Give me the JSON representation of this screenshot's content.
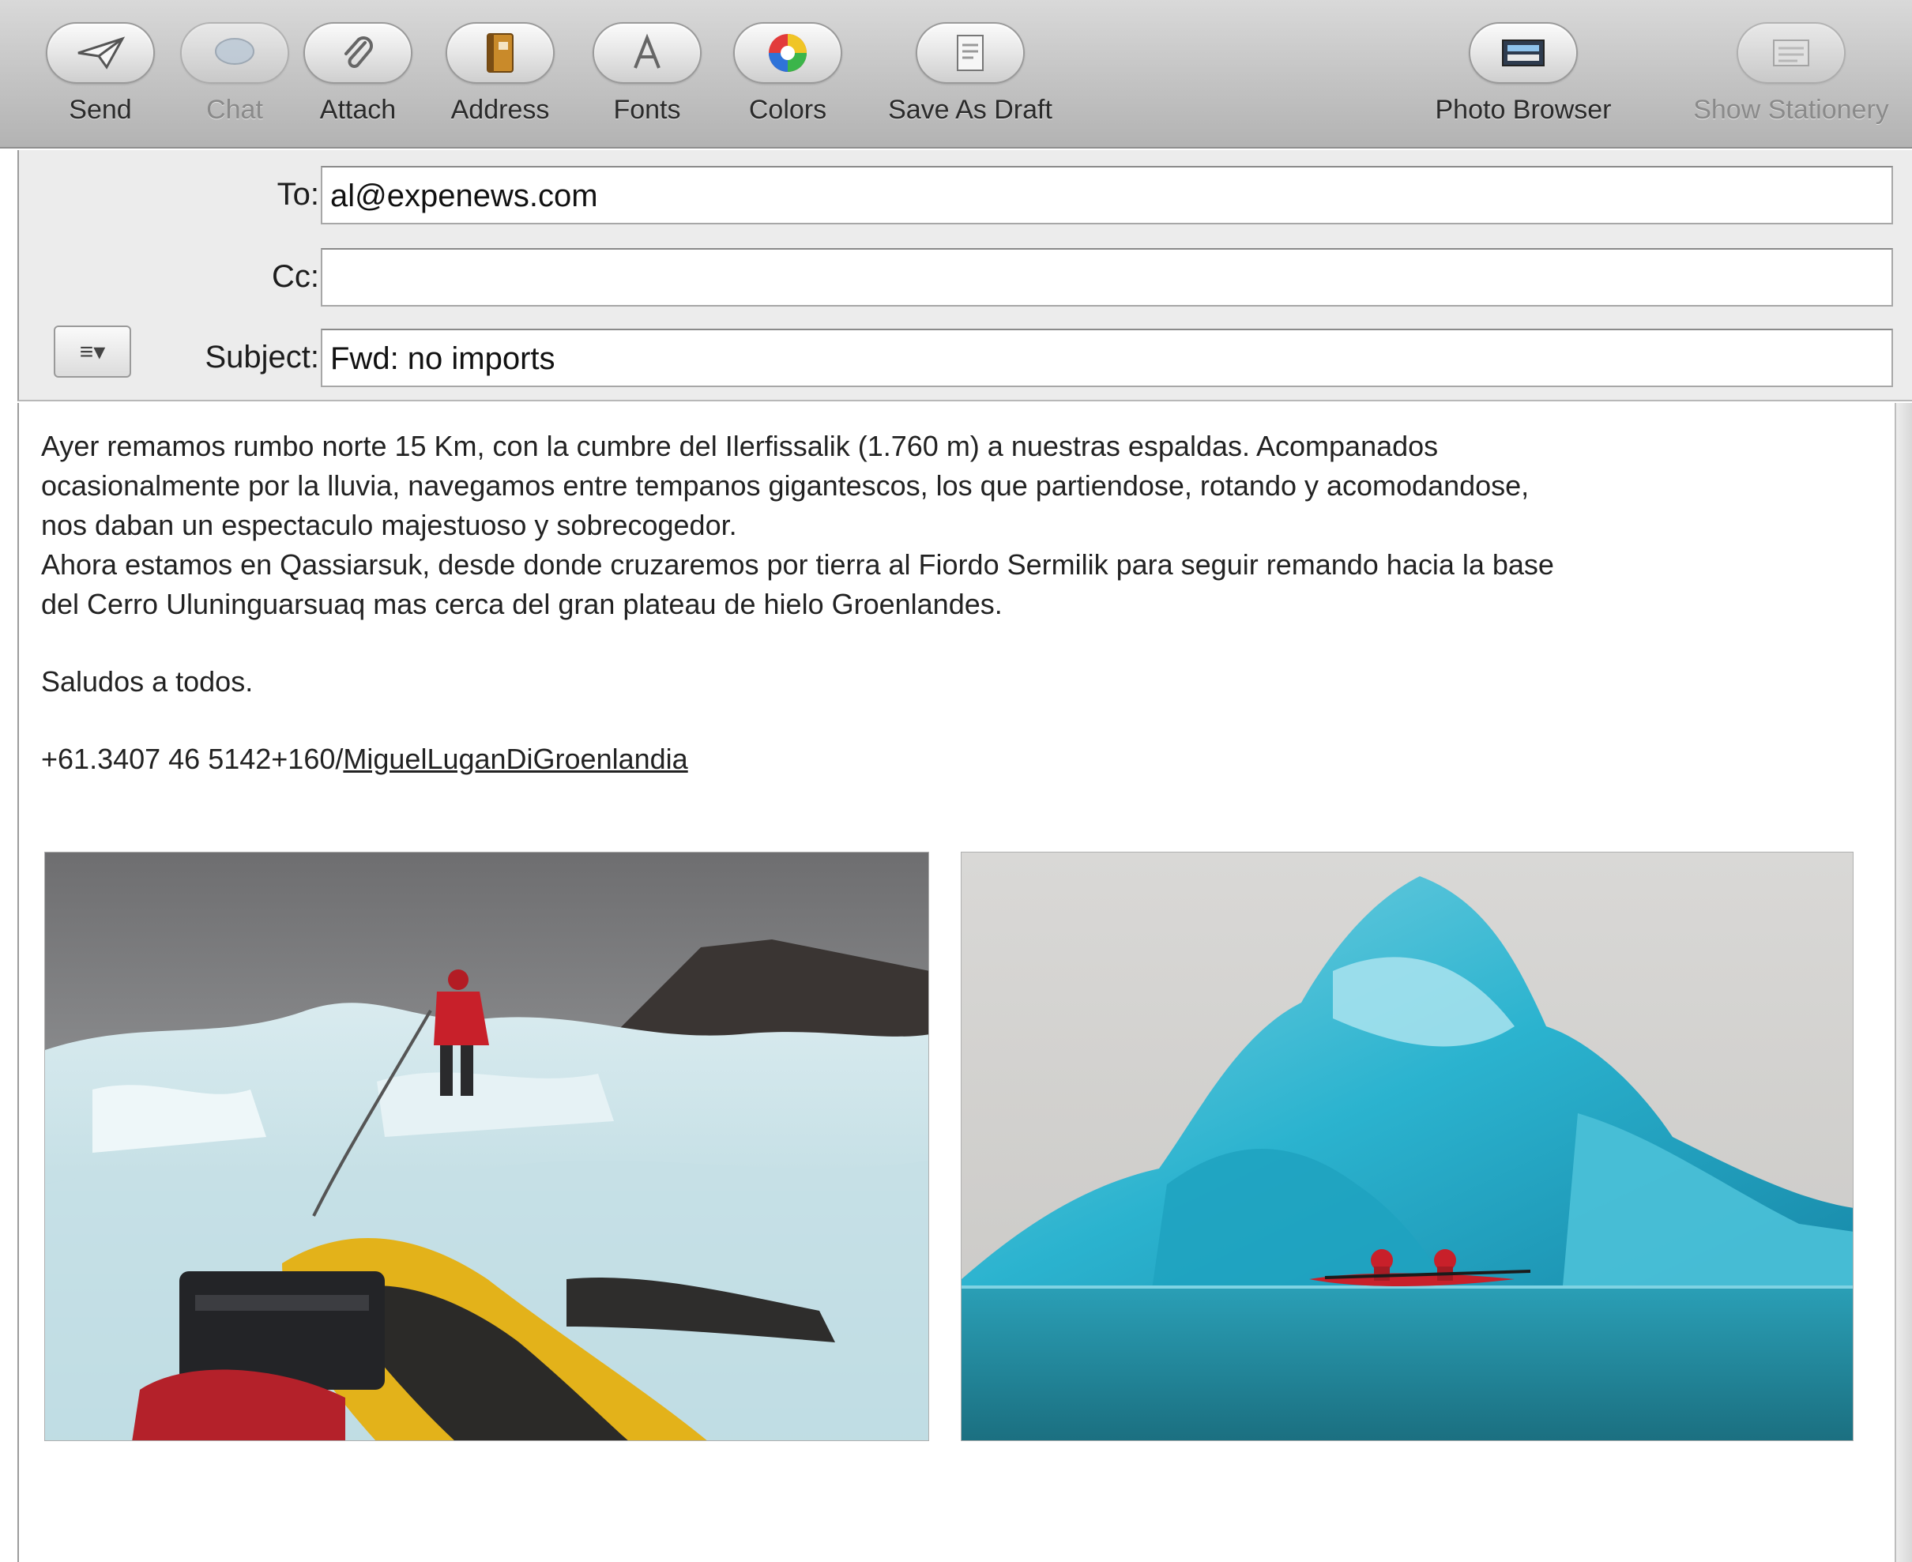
{
  "toolbar": {
    "send": "Send",
    "chat": "Chat",
    "attach": "Attach",
    "address": "Address",
    "fonts": "Fonts",
    "colors": "Colors",
    "save_as_draft": "Save As Draft",
    "photo_browser": "Photo Browser",
    "show_stationery": "Show Stationery"
  },
  "headers": {
    "to_label": "To:",
    "to_value": "al@expenews.com",
    "cc_label": "Cc:",
    "cc_value": "",
    "subject_label": "Subject:",
    "subject_value": "Fwd: no imports",
    "format_button": "≡▾"
  },
  "message": {
    "line1": "Ayer remamos rumbo norte 15 Km, con la cumbre del Ilerfissalik (1.760 m) a nuestras espaldas. Acompanados",
    "line2": "ocasionalmente por la lluvia, navegamos entre tempanos gigantescos, los que partiendose, rotando y acomodandose,",
    "line3": "nos daban un espectaculo majestuoso y sobrecogedor.",
    "line4": "Ahora estamos en Qassiarsuk, desde donde cruzaremos por tierra al Fiordo Sermilik para seguir remando hacia la base",
    "line5": "del Cerro Uluninguarsuaq mas cerca del gran plateau de hielo Groenlandes.",
    "greeting": "Saludos a todos.",
    "signature_text": "+61.3407 46 5142+160/",
    "signature_link": "MiguelLuganDiGroenlandia"
  },
  "colors": {
    "toolbar_top": "#d9d9d9",
    "toolbar_bottom": "#b3b3b3",
    "header_bg": "#ececec",
    "jacket_red": "#c8202a",
    "kayak_yellow": "#e3b21a",
    "ice_turquoise": "#2bb3cf"
  }
}
